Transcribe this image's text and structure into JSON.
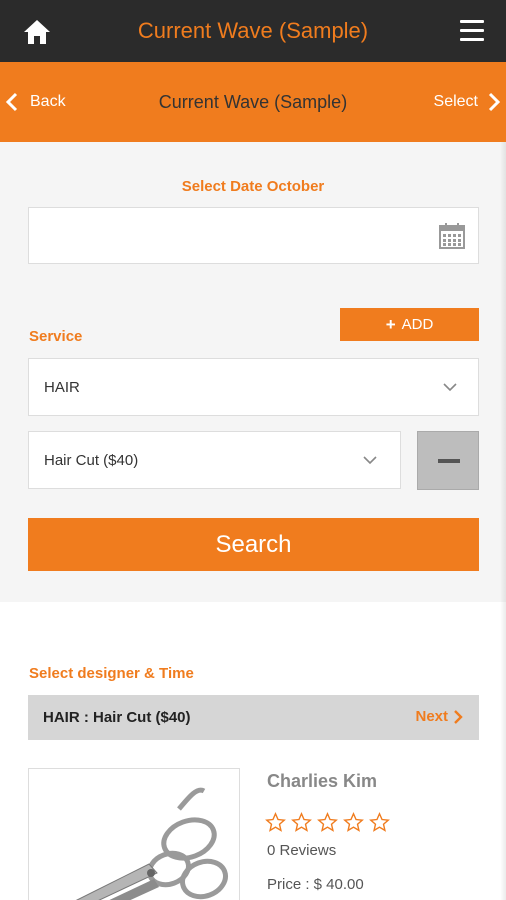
{
  "header": {
    "app_title": "Current Wave (Sample)",
    "home_icon": "home-icon",
    "menu_icon": "hamburger-menu-icon"
  },
  "nav": {
    "back_label": "Back",
    "title": "Current Wave (Sample)",
    "select_label": "Select"
  },
  "date": {
    "label": "Select Date October",
    "value": "",
    "icon": "calendar-icon"
  },
  "service": {
    "label": "Service",
    "add_label": "ADD",
    "category_value": "HAIR",
    "item_value": "Hair Cut ($40)"
  },
  "search_label": "Search",
  "designer": {
    "label": "Select designer & Time",
    "bar_text": "HAIR : Hair Cut ($40)",
    "next_label": "Next",
    "name": "Charlies Kim",
    "rating": 0,
    "max_rating": 5,
    "reviews": "0 Reviews",
    "price": "Price : $ 40.00"
  },
  "colors": {
    "accent": "#f07c1e",
    "dark_bar": "#2b2b2b",
    "panel_bg": "#f5f5f5"
  }
}
